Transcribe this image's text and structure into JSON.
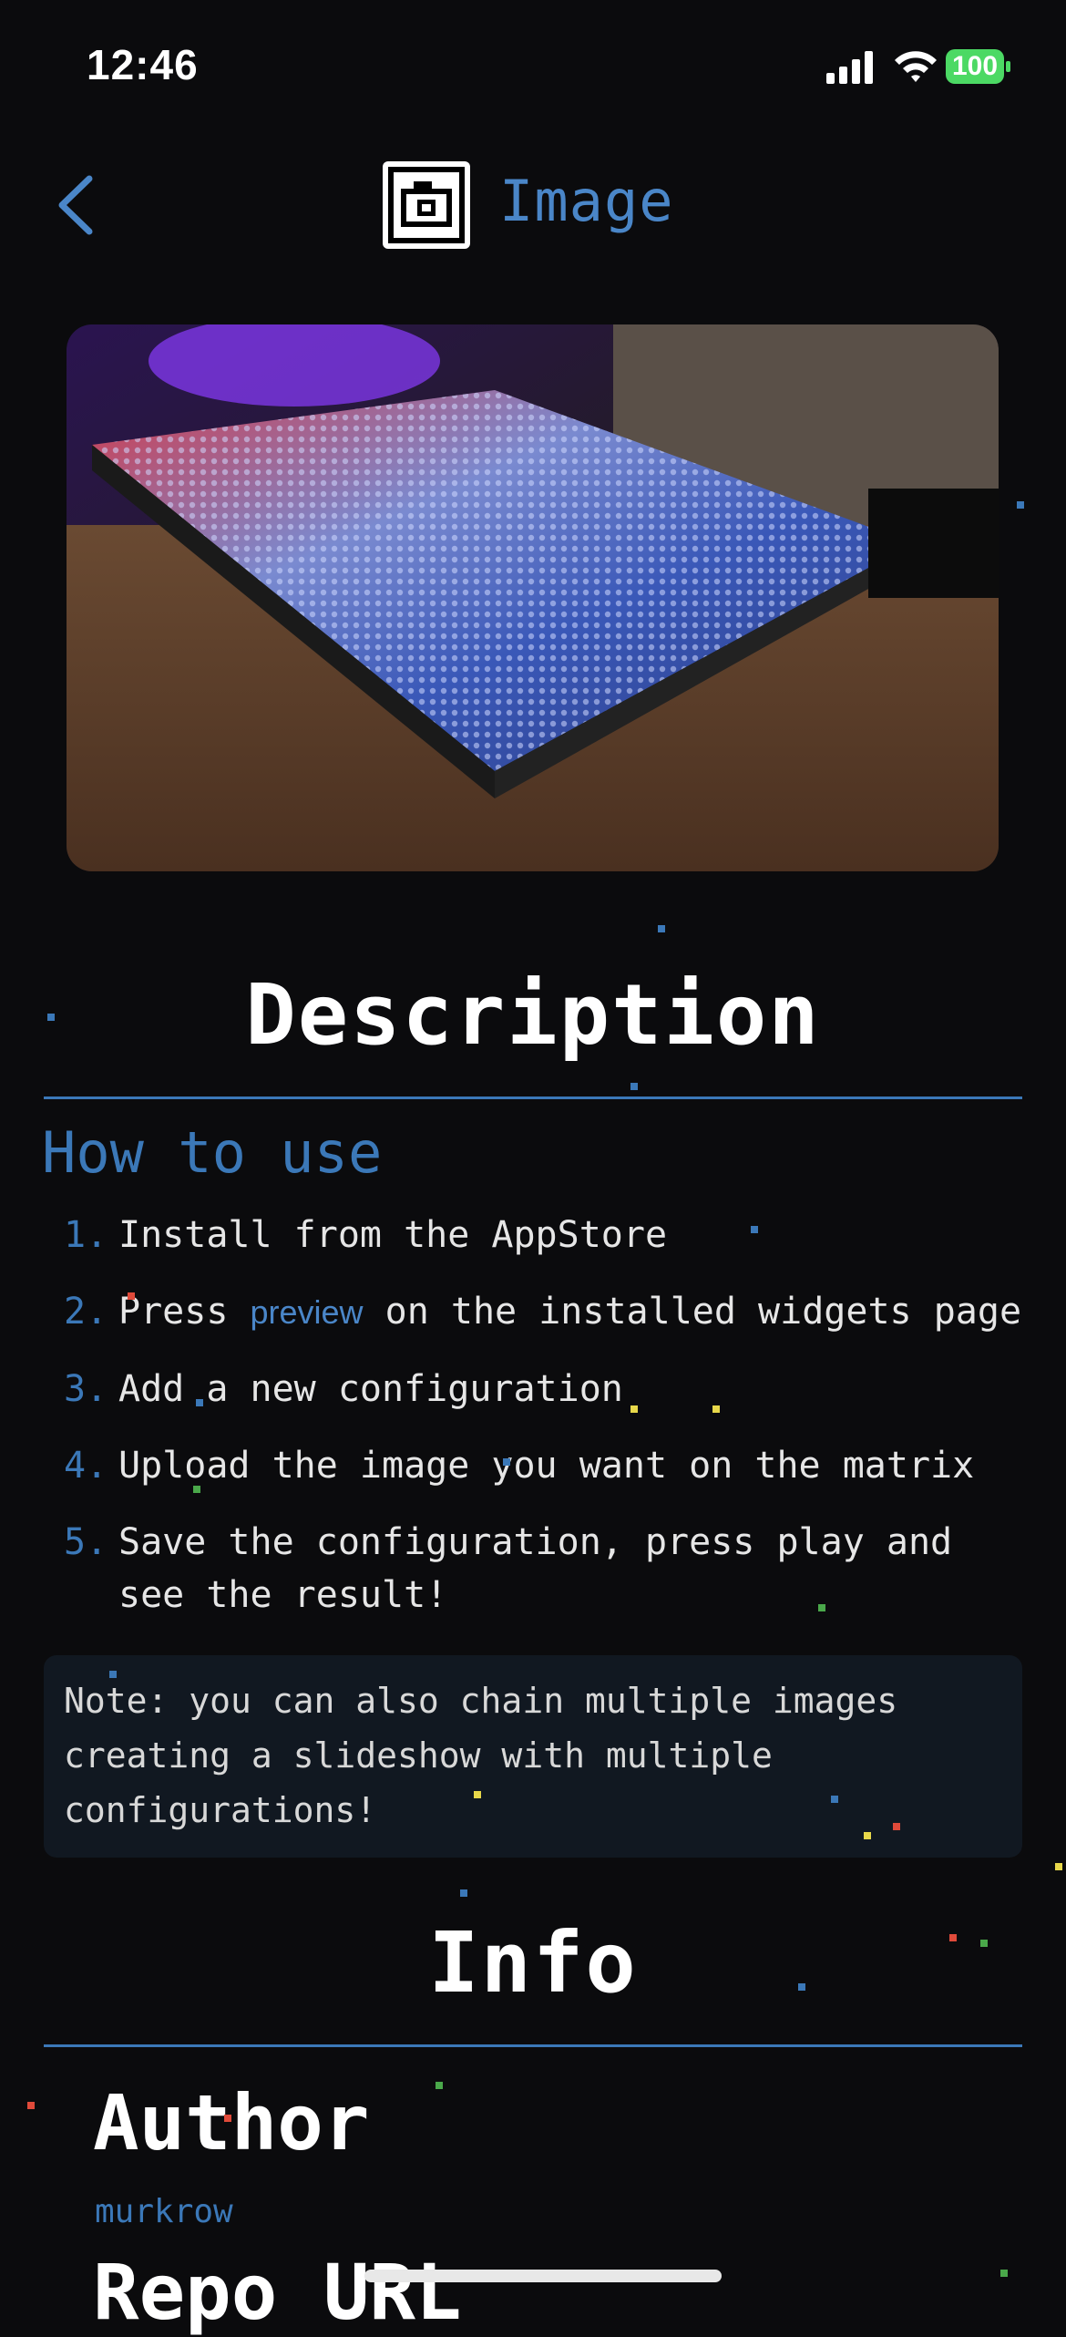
{
  "status_bar": {
    "time": "12:46",
    "battery": "100"
  },
  "nav": {
    "back_label": "Back",
    "title": "Image",
    "icon": "camera-icon"
  },
  "hero": {
    "alt": "LED matrix displaying an image"
  },
  "description": {
    "heading": "Description",
    "how_to_use": "How to use",
    "steps": [
      {
        "num": "1.",
        "text": "Install from the AppStore"
      },
      {
        "num": "2.",
        "pre": "Press ",
        "link": "preview",
        "post": " on the installed widgets page"
      },
      {
        "num": "3.",
        "text": "Add a new configuration"
      },
      {
        "num": "4.",
        "text": "Upload the image you want on the matrix"
      },
      {
        "num": "5.",
        "text": "Save the configuration, press play and see the result!"
      }
    ],
    "note": "Note: you can also chain multiple images creating a slideshow with multiple configurations!"
  },
  "info": {
    "heading": "Info",
    "author_label": "Author",
    "author_name": "murkrow",
    "repo_label": "Repo URL"
  },
  "colors": {
    "accent": "#3b78b8",
    "background": "#0b0b0d",
    "note_bg": "#111821"
  }
}
